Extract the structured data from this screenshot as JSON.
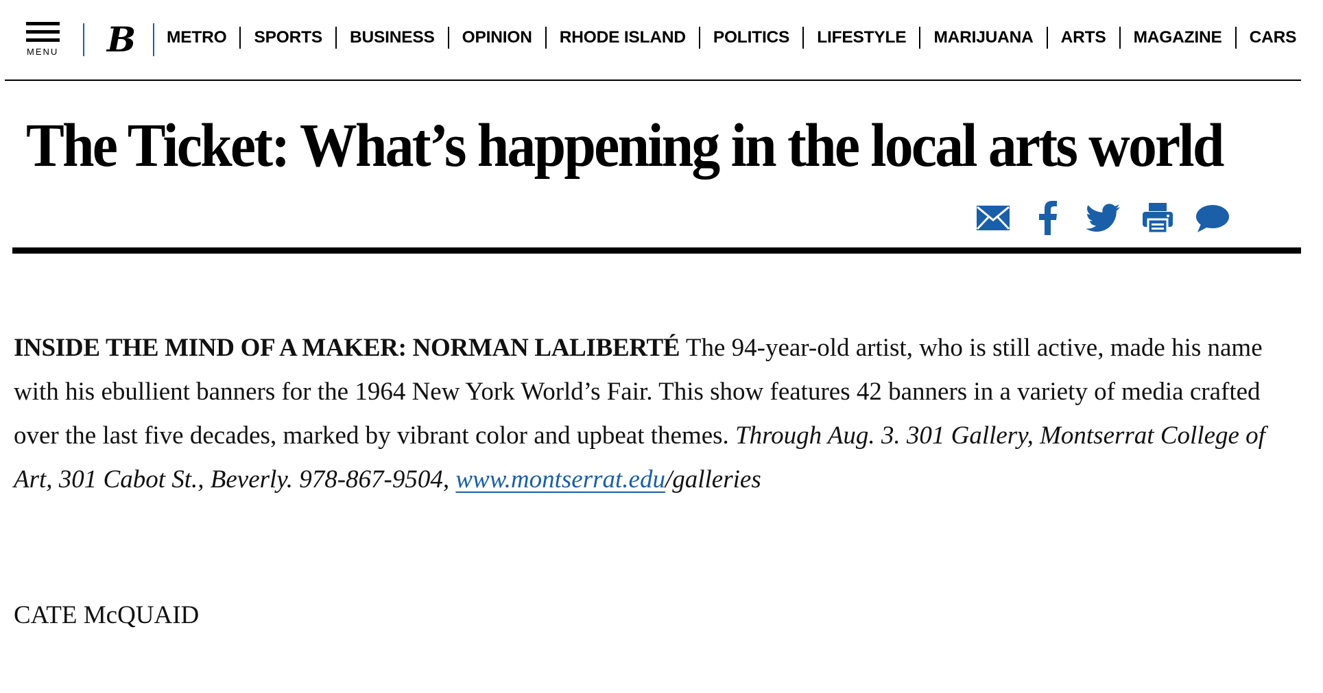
{
  "nav": {
    "menu_label": "MENU",
    "logo_letter": "B",
    "sections": [
      "METRO",
      "SPORTS",
      "BUSINESS",
      "OPINION",
      "RHODE ISLAND",
      "POLITICS",
      "LIFESTYLE",
      "MARIJUANA",
      "ARTS",
      "MAGAZINE",
      "CARS"
    ]
  },
  "article": {
    "headline": "The Ticket: What’s happening in the local arts world",
    "kicker": "INSIDE THE MIND OF A MAKER: NORMAN LALIBERTÉ",
    "body": " The 94-year-old artist, who is still active, made his name with his ebullient banners for the 1964 New York World’s Fair. This show features 42 banners in a variety of media crafted over the last five decades, marked by vibrant color and upbeat themes. ",
    "details_prefix": "Through Aug. 3. 301 Gallery, Montserrat College of Art, 301 Cabot St., Beverly. 978-867-9504, ",
    "link_text": "www.montserrat.edu",
    "details_suffix": "/galleries",
    "byline": "CATE McQUAID"
  },
  "share": {
    "icons": [
      "email-icon",
      "facebook-icon",
      "twitter-icon",
      "print-icon",
      "comment-icon"
    ],
    "color": "#1a5fa8"
  },
  "colors": {
    "accent": "#1a5fa8",
    "text": "#000000"
  }
}
